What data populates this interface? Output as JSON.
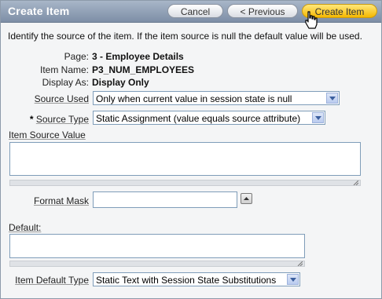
{
  "window": {
    "title": "Create Item"
  },
  "buttons": {
    "cancel": "Cancel",
    "previous": "< Previous",
    "create": "Create Item"
  },
  "intro": "Identify the source of the item. If the item source is null the default value will be used.",
  "details": {
    "page_label": "Page:",
    "page_value": "3 - Employee Details",
    "item_name_label": "Item Name:",
    "item_name_value": "P3_NUM_EMPLOYEES",
    "display_as_label": "Display As:",
    "display_as_value": "Display Only"
  },
  "source_used": {
    "label": "Source Used",
    "value": "Only when current value in session state is null"
  },
  "source_type": {
    "required_marker": "*",
    "label": "Source Type",
    "value": "Static Assignment (value equals source attribute)"
  },
  "item_source_value": {
    "label": "Item Source Value",
    "value": ""
  },
  "format_mask": {
    "label": "Format Mask",
    "value": ""
  },
  "default": {
    "label": "Default:",
    "value": ""
  },
  "item_default_type": {
    "label": "Item Default Type",
    "value": "Static Text with Session State Substitutions"
  },
  "icons": {
    "dropdown": "chevron-down-icon",
    "popup": "triangle-up-icon",
    "resize": "resize-grip-icon",
    "cursor": "hand-pointer-icon"
  },
  "colors": {
    "titlebar": "#8c9bb0",
    "primary_button": "#f5b800",
    "field_border": "#7f9db9"
  }
}
